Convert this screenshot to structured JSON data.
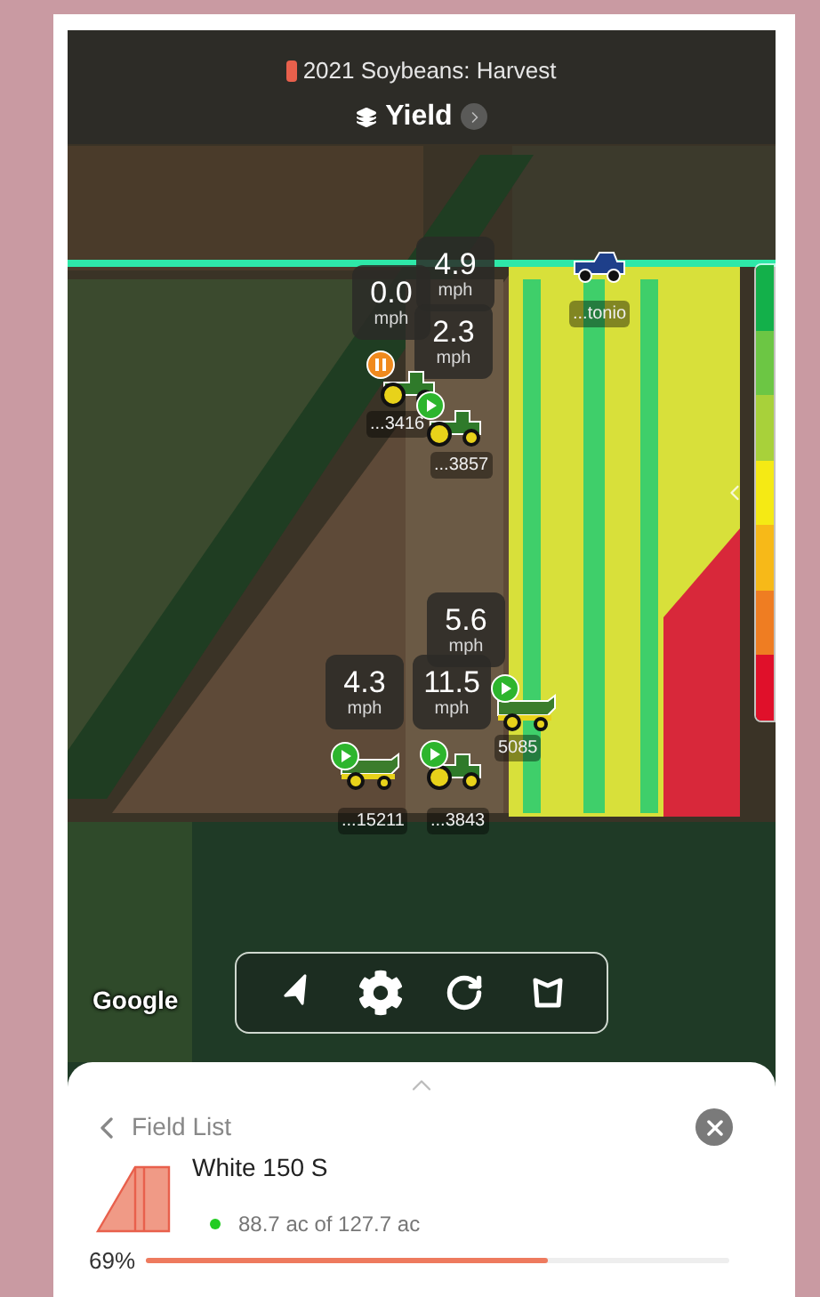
{
  "header": {
    "title": "2021 Soybeans: Harvest",
    "layer": "Yield"
  },
  "speeds": [
    {
      "value": "4.9",
      "unit": "mph"
    },
    {
      "value": "0.0",
      "unit": "mph"
    },
    {
      "value": "2.3",
      "unit": "mph"
    },
    {
      "value": "5.6",
      "unit": "mph"
    },
    {
      "value": "4.3",
      "unit": "mph"
    },
    {
      "value": "11.5",
      "unit": "mph"
    }
  ],
  "truck": {
    "label": "...tonio"
  },
  "vehicles": [
    {
      "kind": "tractor",
      "paused": true,
      "label": "...3416"
    },
    {
      "kind": "tractor",
      "paused": false,
      "label": "...3857"
    },
    {
      "kind": "combine",
      "paused": false,
      "label": "5085"
    },
    {
      "kind": "combine",
      "paused": false,
      "label": "...15211"
    },
    {
      "kind": "tractor",
      "paused": false,
      "label": "...3843"
    }
  ],
  "legend": [
    {
      "color": "#13b04a"
    },
    {
      "color": "#6cc644"
    },
    {
      "color": "#a8d13a"
    },
    {
      "color": "#f5ea14"
    },
    {
      "color": "#f7b918"
    },
    {
      "color": "#ef7d22"
    },
    {
      "color": "#e0102a"
    }
  ],
  "map_attribution": "Google",
  "sheet": {
    "back_label": "Field List",
    "field_name": "White 150 S",
    "area": "88.7 ac of 127.7 ac",
    "percent": "69%",
    "level": 0.69
  }
}
